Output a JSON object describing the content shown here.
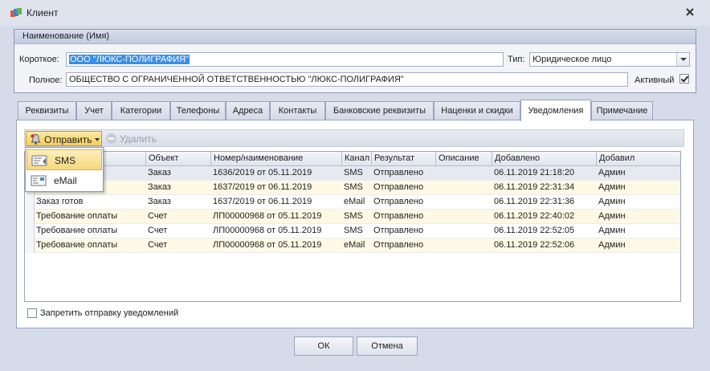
{
  "window": {
    "title": "Клиент"
  },
  "group": {
    "title": "Наименование (Имя)",
    "short_label": "Короткое:",
    "short_value": "ООО \"ЛЮКС-ПОЛИГРАФИЯ\"",
    "type_label": "Тип:",
    "type_value": "Юридическое лицо",
    "full_label": "Полное:",
    "full_value": "ОБЩЕСТВО С ОГРАНИЧЕННОЙ ОТВЕТСТВЕННОСТЬЮ \"ЛЮКС-ПОЛИГРАФИЯ\"",
    "active_label": "Активный",
    "active_checked": true
  },
  "tabs": [
    {
      "label": "Реквизиты"
    },
    {
      "label": "Учет"
    },
    {
      "label": "Категории"
    },
    {
      "label": "Телефоны"
    },
    {
      "label": "Адреса"
    },
    {
      "label": "Контакты"
    },
    {
      "label": "Банковские реквизиты"
    },
    {
      "label": "Наценки и скидки"
    },
    {
      "label": "Уведомления"
    },
    {
      "label": "Примечание"
    }
  ],
  "active_tab": "Уведомления",
  "toolbar": {
    "send_label": "Отправить",
    "delete_label": "Удалить"
  },
  "dropdown": {
    "items": [
      {
        "label": "SMS"
      },
      {
        "label": "eMail"
      }
    ]
  },
  "grid": {
    "columns": [
      "Объект",
      "Номер/наименование",
      "Канал",
      "Результат",
      "Описание",
      "Добавлено",
      "Добавил"
    ],
    "rows": [
      {
        "name": "",
        "object": "Заказ",
        "number": "1636/2019 от 05.11.2019",
        "channel": "SMS",
        "result": "Отправлено",
        "description": "",
        "added": "06.11.2019 21:18:20",
        "author": "Админ"
      },
      {
        "name": "",
        "object": "Заказ",
        "number": "1637/2019 от 06.11.2019",
        "channel": "SMS",
        "result": "Отправлено",
        "description": "",
        "added": "06.11.2019 22:31:34",
        "author": "Админ"
      },
      {
        "name": "Заказ готов",
        "object": "Заказ",
        "number": "1637/2019 от 06.11.2019",
        "channel": "eMail",
        "result": "Отправлено",
        "description": "",
        "added": "06.11.2019 22:31:36",
        "author": "Админ"
      },
      {
        "name": "Требование оплаты",
        "object": "Счет",
        "number": "ЛП00000968 от 05.11.2019",
        "channel": "SMS",
        "result": "Отправлено",
        "description": "",
        "added": "06.11.2019 22:40:02",
        "author": "Админ"
      },
      {
        "name": "Требование оплаты",
        "object": "Счет",
        "number": "ЛП00000968 от 05.11.2019",
        "channel": "SMS",
        "result": "Отправлено",
        "description": "",
        "added": "06.11.2019 22:52:05",
        "author": "Админ"
      },
      {
        "name": "Требование оплаты",
        "object": "Счет",
        "number": "ЛП00000968 от 05.11.2019",
        "channel": "eMail",
        "result": "Отправлено",
        "description": "",
        "added": "06.11.2019 22:52:06",
        "author": "Админ"
      }
    ]
  },
  "forbid_label": "Запретить отправку уведомлений",
  "buttons": {
    "ok": "ОК",
    "cancel": "Отмена"
  },
  "icons": {
    "app": "client-app-icon",
    "close": "close-icon",
    "send": "bell-icon",
    "delete": "minus-circle-icon",
    "sms": "sms-icon",
    "email": "email-icon"
  }
}
